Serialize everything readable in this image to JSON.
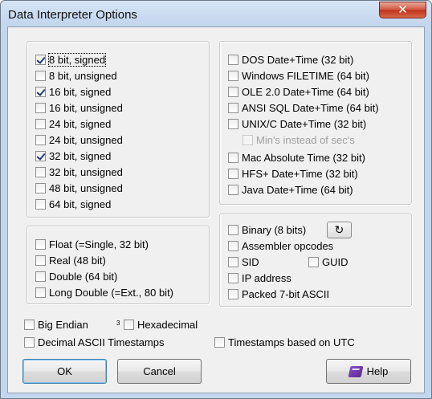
{
  "window": {
    "title": "Data Interpreter Options",
    "close_label": "✕"
  },
  "integer_group": [
    {
      "label": "8 bit, signed",
      "checked": true,
      "focused": true
    },
    {
      "label": "8 bit, unsigned",
      "checked": false
    },
    {
      "label": "16 bit, signed",
      "checked": true
    },
    {
      "label": "16 bit, unsigned",
      "checked": false
    },
    {
      "label": "24 bit, signed",
      "checked": false
    },
    {
      "label": "24 bit, unsigned",
      "checked": false
    },
    {
      "label": "32 bit, signed",
      "checked": true
    },
    {
      "label": "32 bit, unsigned",
      "checked": false
    },
    {
      "label": "48 bit, unsigned",
      "checked": false
    },
    {
      "label": "64 bit, signed",
      "checked": false
    }
  ],
  "float_group": [
    {
      "label": "Float (=Single, 32 bit)",
      "checked": false
    },
    {
      "label": "Real (48 bit)",
      "checked": false
    },
    {
      "label": "Double (64 bit)",
      "checked": false
    },
    {
      "label": "Long Double (=Ext., 80 bit)",
      "checked": false
    }
  ],
  "datetime_group": {
    "dos": "DOS Date+Time (32 bit)",
    "filetime": "Windows FILETIME (64 bit)",
    "ole": "OLE 2.0 Date+Time (64 bit)",
    "ansi": "ANSI SQL Date+Time (64 bit)",
    "unix": "UNIX/C Date+Time (32 bit)",
    "mins": "Min's instead of sec's",
    "mac": "Mac Absolute Time (32 bit)",
    "hfs": "HFS+ Date+Time (32 bit)",
    "java": "Java Date+Time (64 bit)"
  },
  "misc_group": {
    "binary": "Binary (8 bits)",
    "cycle_label": "↻",
    "assembler": "Assembler opcodes",
    "sid": "SID",
    "guid": "GUID",
    "ip": "IP address",
    "packed": "Packed 7-bit ASCII"
  },
  "bottom": {
    "big_endian": "Big Endian",
    "superscript": "3",
    "hexadecimal": "Hexadecimal",
    "decimal_ascii": "Decimal ASCII Timestamps",
    "timestamps_utc": "Timestamps based on UTC"
  },
  "buttons": {
    "ok": "OK",
    "cancel": "Cancel",
    "help": "Help"
  }
}
